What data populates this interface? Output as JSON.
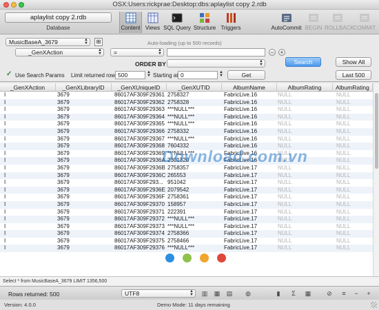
{
  "window": {
    "title": "OSX:Users:rickprae:Desktop:dbs:aplaylist copy 2.rdb"
  },
  "toolbar": {
    "database_value": "aplaylist copy 2.rdb",
    "database_label": "Database",
    "buttons": [
      {
        "label": "Content",
        "icon": "content-icon",
        "active": true
      },
      {
        "label": "Views",
        "icon": "views-icon"
      },
      {
        "label": "SQL Query",
        "icon": "sql-query-icon"
      },
      {
        "label": "Structure",
        "icon": "structure-icon"
      },
      {
        "label": "Triggers",
        "icon": "triggers-icon"
      },
      {
        "label": "AutoCommit",
        "icon": "autocommit-icon"
      },
      {
        "label": "BEGIN",
        "icon": "begin-icon",
        "disabled": true
      },
      {
        "label": "ROLLBACK",
        "icon": "rollback-icon",
        "disabled": true
      },
      {
        "label": "COMMIT",
        "icon": "commit-icon",
        "disabled": true
      }
    ]
  },
  "controls": {
    "table_select": "MusicBaseA_3679",
    "autoloading_hint": "Auto-loading (up to 500 records)",
    "field_select": "_GenXAction",
    "operator_select": "=",
    "search_value": "",
    "order_by_label": "ORDER BY",
    "order_by_value": "",
    "search_button": "Search",
    "show_all_button": "Show All",
    "last_button": "Last 500",
    "use_search_params": "Use Search Params",
    "limit_label": "Limit returned rows:",
    "limit_value": "500",
    "starting_label": "Starting at:",
    "starting_value": "0",
    "get_button": "Get"
  },
  "grid": {
    "columns": [
      "_GenXAction",
      "_GenXLibraryID",
      "_GenXUniqueID",
      "_GenXUTID",
      "AlbumName",
      "AlbumRating",
      "AlbumRating"
    ],
    "rows": [
      [
        "I",
        "3679",
        "86017AF309F29361",
        "2758327",
        "FabricLive.16",
        "NULL",
        "NULL"
      ],
      [
        "I",
        "3679",
        "86017AF309F29362",
        "2758328",
        "FabricLive.16",
        "NULL",
        "NULL"
      ],
      [
        "I",
        "3679",
        "86017AF309F29363",
        "***NULL***",
        "FabricLive.16",
        "NULL",
        "NULL"
      ],
      [
        "I",
        "3679",
        "86017AF309F29364",
        "***NULL***",
        "FabricLive.16",
        "NULL",
        "NULL"
      ],
      [
        "I",
        "3679",
        "86017AF309F29365",
        "***NULL***",
        "FabricLive.16",
        "NULL",
        "NULL"
      ],
      [
        "I",
        "3679",
        "86017AF309F29366",
        "2758332",
        "FabricLive.16",
        "NULL",
        "NULL"
      ],
      [
        "I",
        "3679",
        "86017AF309F29367",
        "***NULL***",
        "FabricLive.16",
        "NULL",
        "NULL"
      ],
      [
        "I",
        "3679",
        "86017AF309F29368",
        "7604332",
        "FabricLive.16",
        "NULL",
        "NULL"
      ],
      [
        "I",
        "3679",
        "86017AF309F29369",
        "***NULL***",
        "FabricLive.16",
        "NULL",
        "NULL"
      ],
      [
        "I",
        "3679",
        "86017AF309F2936A",
        "2301320",
        "FabricLive.16",
        "NULL",
        "NULL"
      ],
      [
        "I",
        "3679",
        "86017AF309F2936B",
        "2758357",
        "FabricLive.17",
        "NULL",
        "NULL"
      ],
      [
        "I",
        "3679",
        "86017AF309F2936C",
        "265553",
        "FabricLive.17",
        "NULL",
        "NULL"
      ],
      [
        "I",
        "3679",
        "86017AF309F293...",
        "951042",
        "FabricLive.17",
        "NULL",
        "NULL"
      ],
      [
        "I",
        "3679",
        "86017AF309F2936E",
        "2079542",
        "FabricLive.17",
        "NULL",
        "NULL"
      ],
      [
        "I",
        "3679",
        "86017AF309F2936F",
        "2758361",
        "FabricLive.17",
        "NULL",
        "NULL"
      ],
      [
        "I",
        "3679",
        "86017AF309F29370",
        "158957",
        "FabricLive.17",
        "NULL",
        "NULL"
      ],
      [
        "I",
        "3679",
        "86017AF309F29371",
        "222391",
        "FabricLive.17",
        "NULL",
        "NULL"
      ],
      [
        "I",
        "3679",
        "86017AF309F29372",
        "***NULL***",
        "FabricLive.17",
        "NULL",
        "NULL"
      ],
      [
        "I",
        "3679",
        "86017AF309F29373",
        "***NULL***",
        "FabricLive.17",
        "NULL",
        "NULL"
      ],
      [
        "I",
        "3679",
        "86017AF309F29374",
        "2758366",
        "FabricLive.17",
        "NULL",
        "NULL"
      ],
      [
        "I",
        "3679",
        "86017AF309F29375",
        "2758466",
        "FabricLive.17",
        "NULL",
        "NULL"
      ],
      [
        "I",
        "3679",
        "86017AF309F29376",
        "***NULL***",
        "FabricLive.17",
        "NULL",
        "NULL"
      ]
    ]
  },
  "status": {
    "query_text": "Select * from MusicBaseA_3679 LIMIT 1356,500",
    "rows_returned": "Rows returned: 500",
    "encoding": "UTF8",
    "version": "Version: 4.0.0",
    "demo_mode": "Demo Mode: 11 days remaining"
  },
  "watermark": {
    "text": "Download.com.vn",
    "dot_colors": [
      "#2d8fe0",
      "#8ec24b",
      "#f0a52c",
      "#e0463c"
    ]
  },
  "colors": {
    "accent": "#4a98ec",
    "row_alt": "#eef3fa",
    "null_text": "#b3b3b3"
  }
}
